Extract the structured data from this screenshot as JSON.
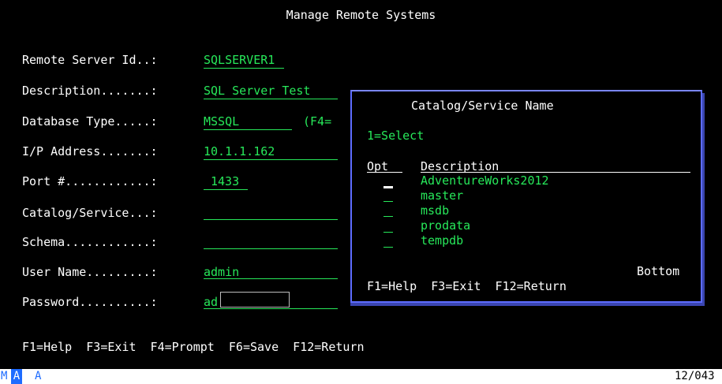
{
  "screen": {
    "title": "Manage Remote Systems",
    "fields": {
      "remote_server_id": {
        "label": "Remote Server Id..:",
        "value": "SQLSERVER1"
      },
      "description": {
        "label": "Description.......:",
        "value": "SQL Server Test"
      },
      "database_type": {
        "label": "Database Type.....:",
        "value": "MSSQL",
        "hint": "(F4="
      },
      "ip_address": {
        "label": "I/P Address.......:",
        "value": "10.1.1.162"
      },
      "port": {
        "label": "Port #............:",
        "value": "1433"
      },
      "catalog_service": {
        "label": "Catalog/Service...:",
        "value": ""
      },
      "schema": {
        "label": "Schema............:",
        "value": ""
      },
      "user_name": {
        "label": "User Name.........:",
        "value": "admin"
      },
      "password": {
        "label": "Password..........:",
        "value": "ad"
      }
    },
    "function_keys": "F1=Help  F3=Exit  F4=Prompt  F6=Save  F12=Return"
  },
  "popup": {
    "title": "Catalog/Service Name",
    "instructions": "1=Select",
    "col_opt": "Opt",
    "col_description": "Description",
    "items": [
      "AdventureWorks2012",
      "master",
      "msdb",
      "prodata",
      "tempdb"
    ],
    "more": "Bottom",
    "function_keys": "F1=Help  F3=Exit  F12=Return"
  },
  "status_bar": {
    "mode_m": "M",
    "mode_a": "A",
    "indicator": "A",
    "cursor_pos": "12/043"
  },
  "colors": {
    "background": "#000000",
    "field_green": "#27e85a",
    "popup_border": "#5d6cff",
    "status_blue": "#1e6cff"
  }
}
